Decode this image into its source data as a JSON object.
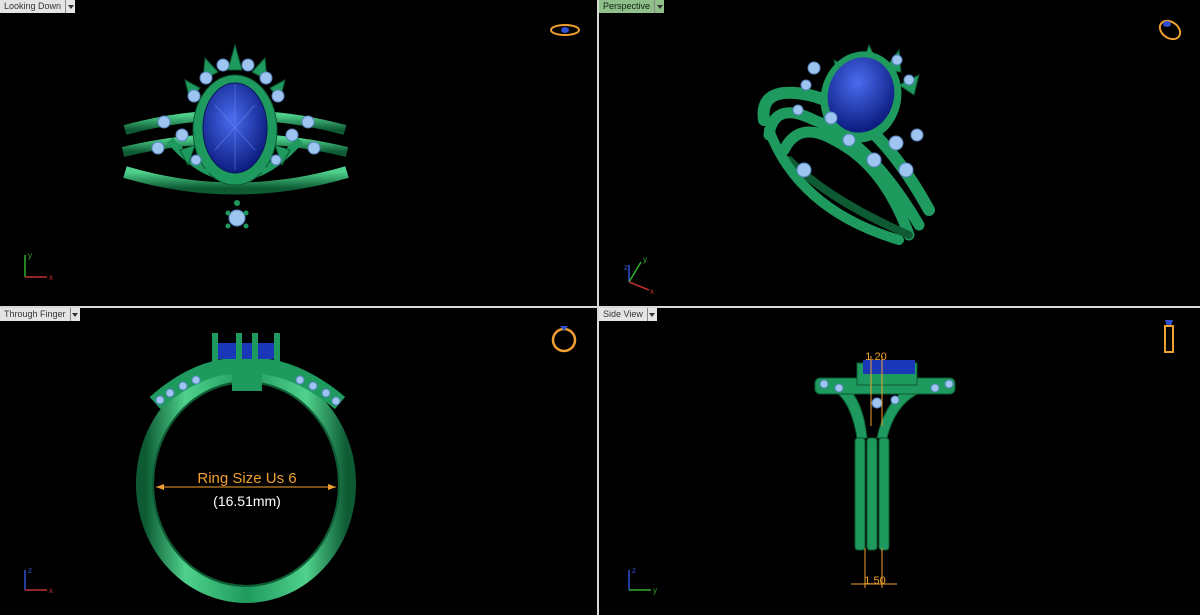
{
  "viewports": {
    "top_left": {
      "label": "Looking Down",
      "active": false,
      "axes": [
        "y",
        "x"
      ]
    },
    "top_right": {
      "label": "Perspective",
      "active": true,
      "axes": [
        "z",
        "y",
        "x"
      ]
    },
    "bottom_left": {
      "label": "Through Finger",
      "active": false,
      "axes": [
        "z",
        "x"
      ],
      "annotation": {
        "size_label": "Ring Size Us 6",
        "size_mm": "(16.51mm)"
      }
    },
    "bottom_right": {
      "label": "Side View",
      "active": false,
      "axes": [
        "z",
        "y"
      ],
      "dimensions": {
        "top": "1.20",
        "bottom": "1.50"
      }
    }
  },
  "colors": {
    "metal": "#1f9a5e",
    "metal_dark": "#0d5a33",
    "metal_light": "#4fd18c",
    "sapphire": "#1a37b8",
    "sapphire_light": "#4a6cf0",
    "diamond": "#9ec4f0",
    "dimension": "#f0a030",
    "axis_x": "#c03030",
    "axis_y": "#30b030",
    "axis_z": "#3050d0",
    "background": "#000000",
    "tab_active": "#8fc08a"
  },
  "icons": [
    "ring-top-icon",
    "ring-perspective-icon",
    "ring-front-icon",
    "ring-side-icon",
    "dropdown-arrow-icon"
  ]
}
